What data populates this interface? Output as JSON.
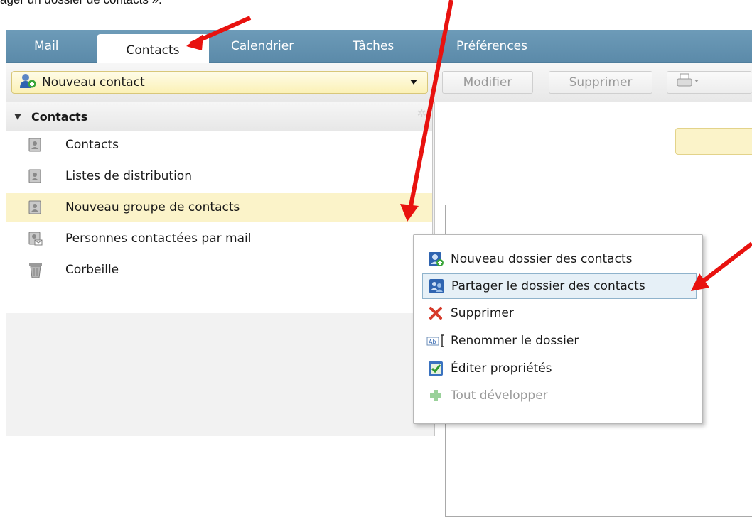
{
  "caption": "ager un dossier de contacts ».",
  "tabs": [
    {
      "label": "Mail"
    },
    {
      "label": "Contacts",
      "active": true
    },
    {
      "label": "Calendrier"
    },
    {
      "label": "Tâches"
    },
    {
      "label": "Préférences"
    }
  ],
  "toolbar": {
    "new_contact_label": "Nouveau contact",
    "edit_label": "Modifier",
    "delete_label": "Supprimer"
  },
  "sidebar": {
    "header": "Contacts",
    "folders": [
      {
        "label": "Contacts",
        "icon": "address-book-icon"
      },
      {
        "label": "Listes de distribution",
        "icon": "address-book-icon"
      },
      {
        "label": "Nouveau groupe de contacts",
        "icon": "address-book-icon",
        "selected": true
      },
      {
        "label": "Personnes contactées par mail",
        "icon": "emailed-contacts-icon"
      },
      {
        "label": "Corbeille",
        "icon": "trash-icon"
      }
    ]
  },
  "context_menu": {
    "items": [
      {
        "label": "Nouveau dossier des contacts",
        "icon": "new-folder-icon"
      },
      {
        "label": "Partager le dossier des contacts",
        "icon": "share-folder-icon",
        "highlighted": true
      },
      {
        "label": "Supprimer",
        "icon": "delete-x-icon"
      },
      {
        "label": "Renommer le dossier",
        "icon": "rename-icon"
      },
      {
        "label": "Éditer propriétés",
        "icon": "edit-properties-icon"
      },
      {
        "label": "Tout développer",
        "icon": "expand-all-icon",
        "disabled": true
      }
    ]
  },
  "colors": {
    "tab_bar": "#5b8aa9",
    "selection": "#fbf3c9",
    "annotation_arrow": "#e8120f"
  }
}
